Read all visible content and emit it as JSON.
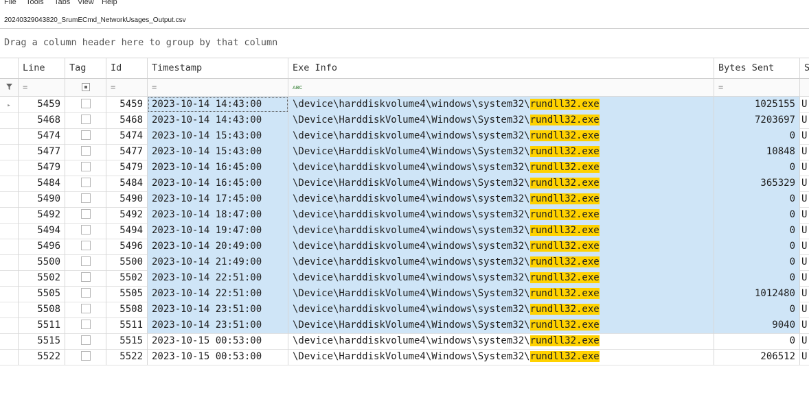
{
  "menu": [
    "File",
    "Tools",
    "Tabs",
    "View",
    "Help"
  ],
  "tab": {
    "title": "20240329043820_SrumECmd_NetworkUsages_Output.csv"
  },
  "group_panel": {
    "hint": "Drag a column header here to group by that column"
  },
  "icons": {
    "filter": "filter-funnel-icon",
    "row_indicator": "current-row-arrow-icon",
    "equals": "equals-filter-icon",
    "abc": "text-filter-icon"
  },
  "colors": {
    "selection": "#cfe5f7",
    "highlight": "#ffd200"
  },
  "columns": [
    "Line",
    "Tag",
    "Id",
    "Timestamp",
    "Exe Info",
    "Bytes Sent",
    "S"
  ],
  "filters": {
    "equals": "=",
    "abc": "ABC"
  },
  "rows": [
    {
      "line": "5459",
      "id": "5459",
      "timestamp": "2023-10-14 14:43:00",
      "exe_prefix": "\\device\\harddiskvolume4\\windows\\system32\\",
      "exe_match": "rundll32.exe",
      "bytes_sent": "1025155",
      "s": "U"
    },
    {
      "line": "5468",
      "id": "5468",
      "timestamp": "2023-10-14 14:43:00",
      "exe_prefix": "\\Device\\HarddiskVolume4\\Windows\\System32\\",
      "exe_match": "rundll32.exe",
      "bytes_sent": "7203697",
      "s": "U"
    },
    {
      "line": "5474",
      "id": "5474",
      "timestamp": "2023-10-14 15:43:00",
      "exe_prefix": "\\device\\harddiskvolume4\\windows\\system32\\",
      "exe_match": "rundll32.exe",
      "bytes_sent": "0",
      "s": "U"
    },
    {
      "line": "5477",
      "id": "5477",
      "timestamp": "2023-10-14 15:43:00",
      "exe_prefix": "\\Device\\HarddiskVolume4\\Windows\\System32\\",
      "exe_match": "rundll32.exe",
      "bytes_sent": "10848",
      "s": "U"
    },
    {
      "line": "5479",
      "id": "5479",
      "timestamp": "2023-10-14 16:45:00",
      "exe_prefix": "\\device\\harddiskvolume4\\windows\\system32\\",
      "exe_match": "rundll32.exe",
      "bytes_sent": "0",
      "s": "U"
    },
    {
      "line": "5484",
      "id": "5484",
      "timestamp": "2023-10-14 16:45:00",
      "exe_prefix": "\\Device\\HarddiskVolume4\\Windows\\System32\\",
      "exe_match": "rundll32.exe",
      "bytes_sent": "365329",
      "s": "U"
    },
    {
      "line": "5490",
      "id": "5490",
      "timestamp": "2023-10-14 17:45:00",
      "exe_prefix": "\\device\\harddiskvolume4\\windows\\system32\\",
      "exe_match": "rundll32.exe",
      "bytes_sent": "0",
      "s": "U"
    },
    {
      "line": "5492",
      "id": "5492",
      "timestamp": "2023-10-14 18:47:00",
      "exe_prefix": "\\device\\harddiskvolume4\\windows\\system32\\",
      "exe_match": "rundll32.exe",
      "bytes_sent": "0",
      "s": "U"
    },
    {
      "line": "5494",
      "id": "5494",
      "timestamp": "2023-10-14 19:47:00",
      "exe_prefix": "\\device\\harddiskvolume4\\windows\\system32\\",
      "exe_match": "rundll32.exe",
      "bytes_sent": "0",
      "s": "U"
    },
    {
      "line": "5496",
      "id": "5496",
      "timestamp": "2023-10-14 20:49:00",
      "exe_prefix": "\\device\\harddiskvolume4\\windows\\system32\\",
      "exe_match": "rundll32.exe",
      "bytes_sent": "0",
      "s": "U"
    },
    {
      "line": "5500",
      "id": "5500",
      "timestamp": "2023-10-14 21:49:00",
      "exe_prefix": "\\device\\harddiskvolume4\\windows\\system32\\",
      "exe_match": "rundll32.exe",
      "bytes_sent": "0",
      "s": "U"
    },
    {
      "line": "5502",
      "id": "5502",
      "timestamp": "2023-10-14 22:51:00",
      "exe_prefix": "\\device\\harddiskvolume4\\windows\\system32\\",
      "exe_match": "rundll32.exe",
      "bytes_sent": "0",
      "s": "U"
    },
    {
      "line": "5505",
      "id": "5505",
      "timestamp": "2023-10-14 22:51:00",
      "exe_prefix": "\\Device\\HarddiskVolume4\\Windows\\System32\\",
      "exe_match": "rundll32.exe",
      "bytes_sent": "1012480",
      "s": "U"
    },
    {
      "line": "5508",
      "id": "5508",
      "timestamp": "2023-10-14 23:51:00",
      "exe_prefix": "\\device\\harddiskvolume4\\windows\\system32\\",
      "exe_match": "rundll32.exe",
      "bytes_sent": "0",
      "s": "U"
    },
    {
      "line": "5511",
      "id": "5511",
      "timestamp": "2023-10-14 23:51:00",
      "exe_prefix": "\\Device\\HarddiskVolume4\\Windows\\System32\\",
      "exe_match": "rundll32.exe",
      "bytes_sent": "9040",
      "s": "U"
    },
    {
      "line": "5515",
      "id": "5515",
      "timestamp": "2023-10-15 00:53:00",
      "exe_prefix": "\\device\\harddiskvolume4\\windows\\system32\\",
      "exe_match": "rundll32.exe",
      "bytes_sent": "0",
      "s": "U"
    },
    {
      "line": "5522",
      "id": "5522",
      "timestamp": "2023-10-15 00:53:00",
      "exe_prefix": "\\Device\\HarddiskVolume4\\Windows\\System32\\",
      "exe_match": "rundll32.exe",
      "bytes_sent": "206512",
      "s": "U"
    }
  ]
}
